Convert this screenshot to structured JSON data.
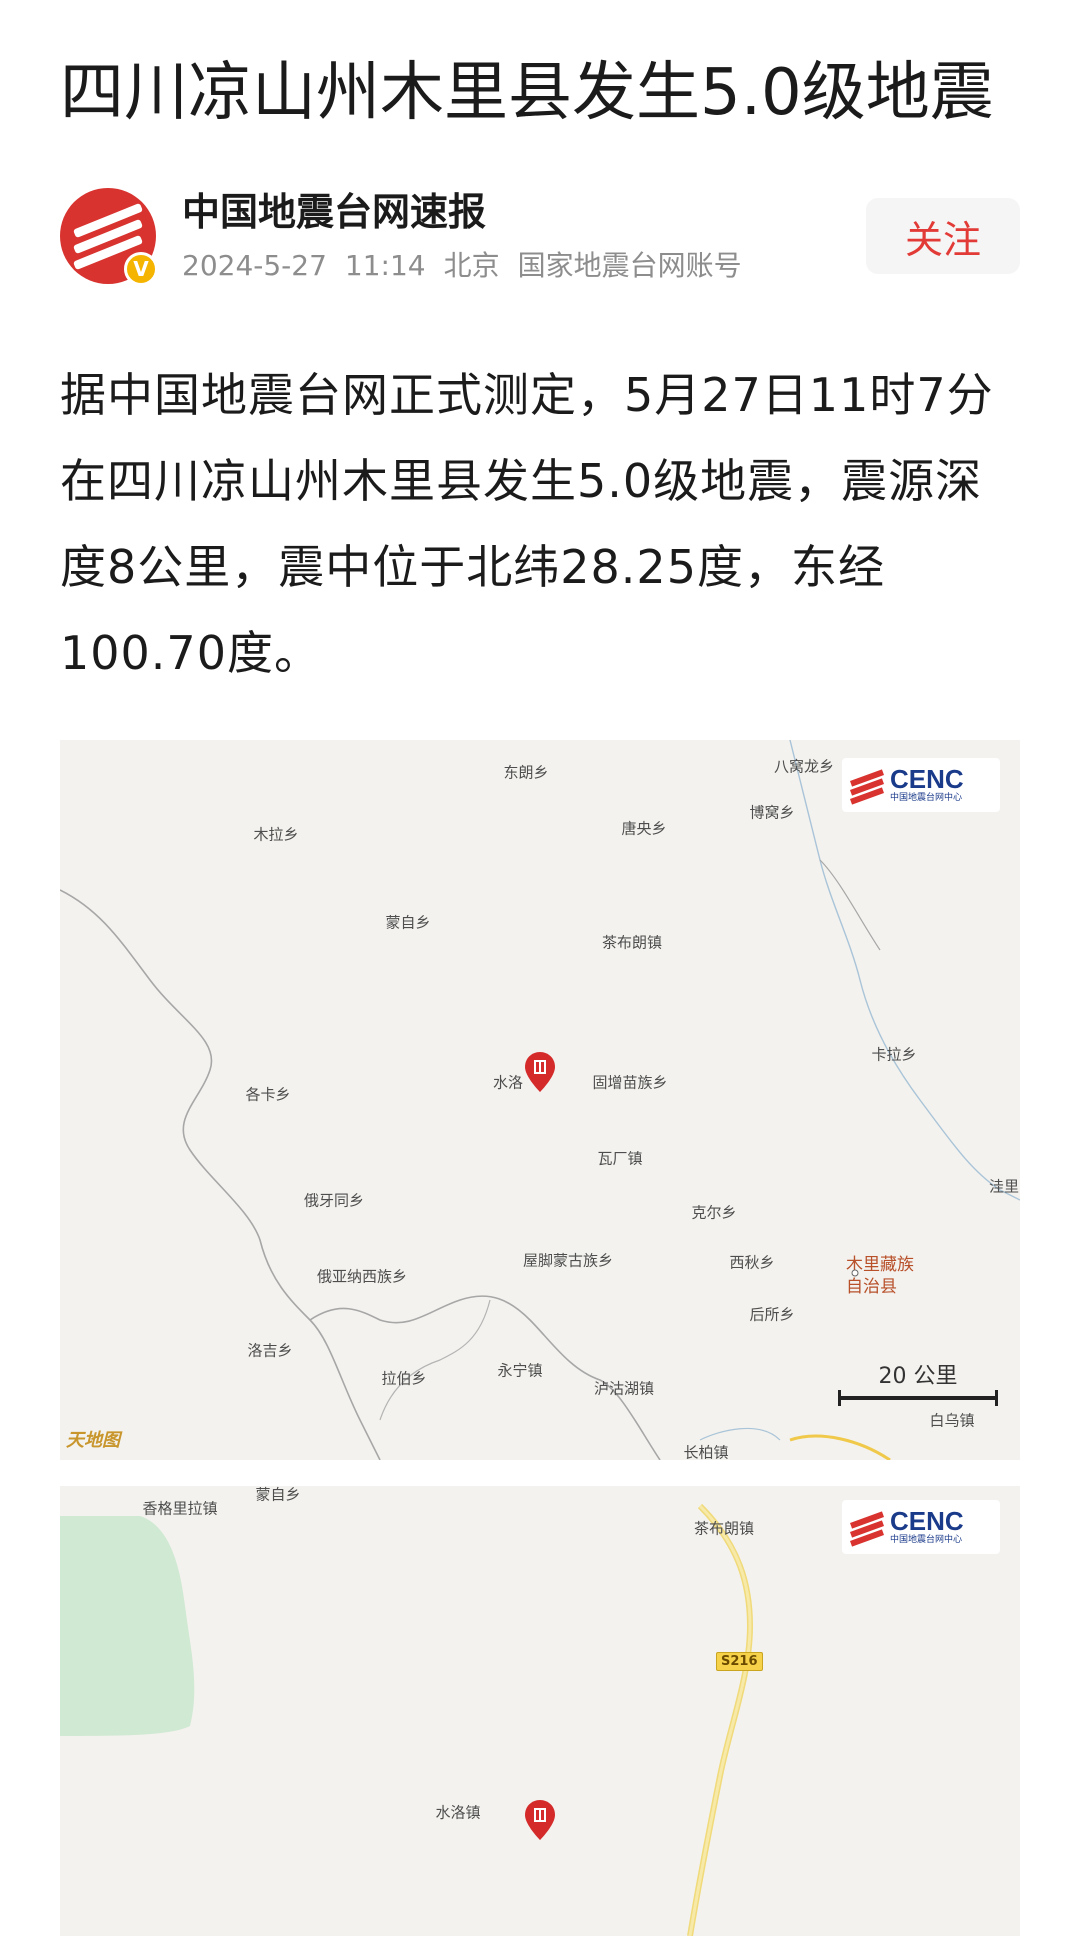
{
  "article": {
    "title": "四川凉山州木里县发生5.0级地震",
    "author": {
      "name": "中国地震台网速报",
      "date": "2024-5-27",
      "time": "11:14",
      "location": "北京",
      "account_type": "国家地震台网账号",
      "verified_badge": "V",
      "follow_label": "关注"
    },
    "body": "据中国地震台网正式测定，5月27日11时7分在四川凉山州木里县发生5.0级地震，震源深度8公里，震中位于北纬28.25度，东经100.70度。"
  },
  "map1": {
    "logo_en": "CENC",
    "logo_cn": "中国地震台网中心",
    "scale_label": "20 公里",
    "watermark": "天地图",
    "places": {
      "p1": "东朗乡",
      "p2": "八窝龙乡",
      "p3": "木拉乡",
      "p4": "唐央乡",
      "p5": "博窝乡",
      "p6": "蒙自乡",
      "p7": "茶布朗镇",
      "p8": "卡拉乡",
      "p9": "水洛",
      "p10": "固增苗族乡",
      "p11": "各卡乡",
      "p12": "瓦厂镇",
      "p13": "洼里",
      "p14": "俄牙同乡",
      "p15": "克尔乡",
      "p16": "屋脚蒙古族乡",
      "p17": "西秋乡",
      "p18": "俄亚纳西族乡",
      "p19": "后所乡",
      "p20": "洛吉乡",
      "p21": "拉伯乡",
      "p22": "永宁镇",
      "p23": "泸沽湖镇",
      "p24": "白乌镇",
      "p25": "长柏镇"
    },
    "county_label_line1": "木里藏族",
    "county_label_line2": "自治县"
  },
  "map2": {
    "logo_en": "CENC",
    "logo_cn": "中国地震台网中心",
    "places": {
      "p1": "香格里拉镇",
      "p2": "蒙自乡",
      "p3": "茶布朗镇",
      "p4": "水洛镇"
    },
    "road": "S216"
  },
  "colors": {
    "accent_red": "#e23b37",
    "map_background": "#f3f2ee",
    "verified_yellow": "#f4b400"
  }
}
